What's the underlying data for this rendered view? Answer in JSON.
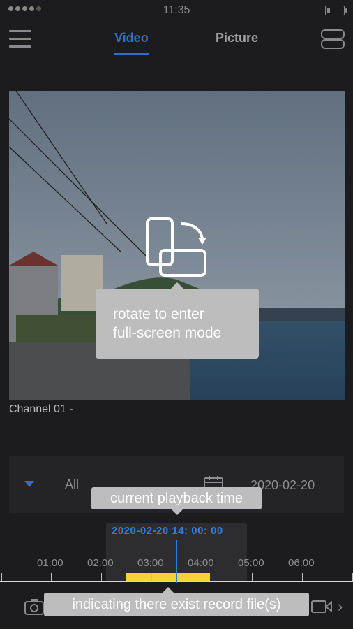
{
  "status_bar": {
    "time": "11:35"
  },
  "nav": {
    "tabs": [
      {
        "label": "Video",
        "active": true
      },
      {
        "label": "Picture",
        "active": false
      }
    ]
  },
  "player": {
    "tooltip": "rotate to enter\nfull-screen mode",
    "channel_label": "Channel 01 -"
  },
  "filter": {
    "type_value": "All",
    "date_value": "2020-02-20"
  },
  "timeline": {
    "tooltip_current": "current playback time",
    "current_time": "2020-02-20 14: 00: 00",
    "ticks": [
      "01:00",
      "02:00",
      "03:00",
      "04:00",
      "05:00",
      "06:00"
    ],
    "tooltip_record": "indicating there exist record file(s)"
  },
  "colors": {
    "accent": "#2f6fbf",
    "record": "#f2d535",
    "background": "#1c1c1e",
    "tooltip": "#bdbdbd"
  },
  "icons": {
    "menu": "hamburger-icon",
    "toggle": "toggle-icon",
    "rotate": "rotate-device-icon",
    "calendar": "calendar-icon",
    "camera": "camera-icon",
    "record": "video-camera-icon",
    "next": "chevron-right-icon"
  }
}
